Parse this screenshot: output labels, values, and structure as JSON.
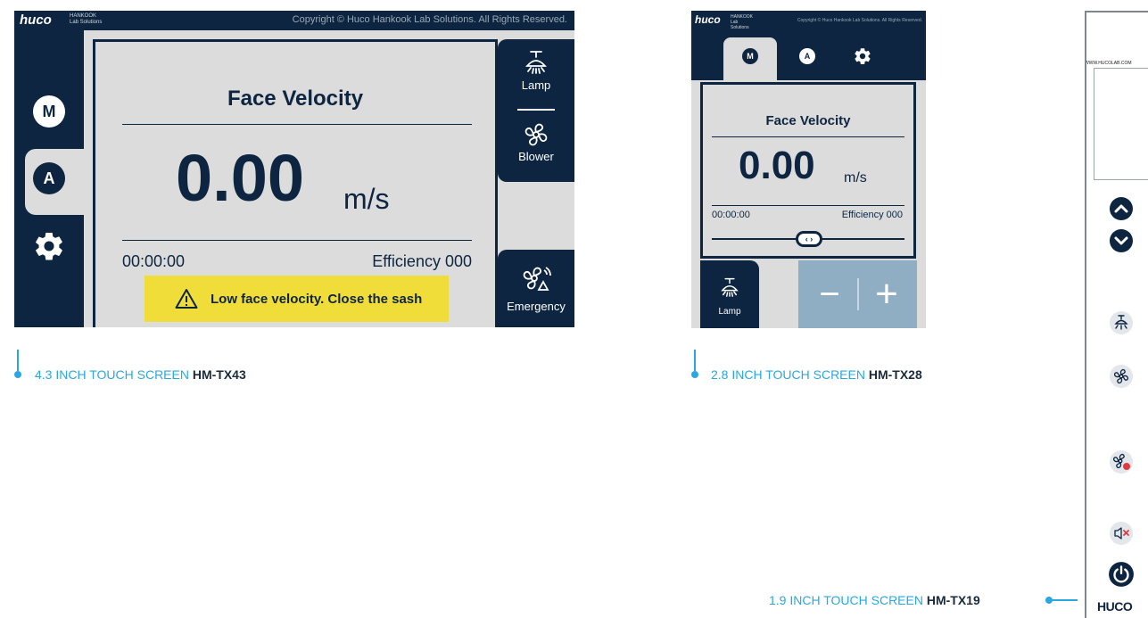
{
  "screen43": {
    "brand": "huco",
    "brand_sub": "HANKOOK Lab Solutions",
    "copyright": "Copyright © Huco Hankook Lab Solutions. All Rights Reserved.",
    "mode_m": "M",
    "mode_a": "A",
    "title": "Face Velocity",
    "value": "0.00",
    "unit": "m/s",
    "timer": "00:00:00",
    "efficiency": "Efficiency 000",
    "warning": "Low face velocity. Close the sash",
    "lamp_label": "Lamp",
    "blower_label": "Blower",
    "emergency_label": "Emergency"
  },
  "screen28": {
    "brand": "huco",
    "brand_sub": "HANKOOK Lab Solutions",
    "copyright": "Copyright © Huco Hankook Lab Solutions. All Rights Reserved.",
    "mode_m": "M",
    "mode_a": "A",
    "title": "Face Velocity",
    "value": "0.00",
    "unit": "m/s",
    "timer": "00:00:00",
    "efficiency": "Efficiency 000",
    "slider_glyph": "‹ ›",
    "lamp_label": "Lamp",
    "minus": "−",
    "plus": "+"
  },
  "screen19": {
    "url": "WWW.HUCOLAB.COM",
    "brand": "HUCO",
    "icons": [
      "chevron-up-icon",
      "chevron-down-icon",
      "lamp-icon",
      "fan-icon",
      "emergency-fan-icon",
      "mute-icon",
      "power-icon"
    ]
  },
  "captions": {
    "c43_prefix": "4.3 INCH TOUCH SCREEN ",
    "c43_model": "HM-TX43",
    "c28_prefix": "2.8 INCH TOUCH SCREEN ",
    "c28_model": "HM-TX28",
    "c19_prefix": "1.9 INCH TOUCH SCREEN ",
    "c19_model": "HM-TX19"
  },
  "colors": {
    "navy": "#0d2540",
    "panel_gray": "#dcdcdc",
    "warning_yellow": "#f1dd3a",
    "accent_blue": "#2aa7e1",
    "button_blue": "#8fadc3"
  }
}
